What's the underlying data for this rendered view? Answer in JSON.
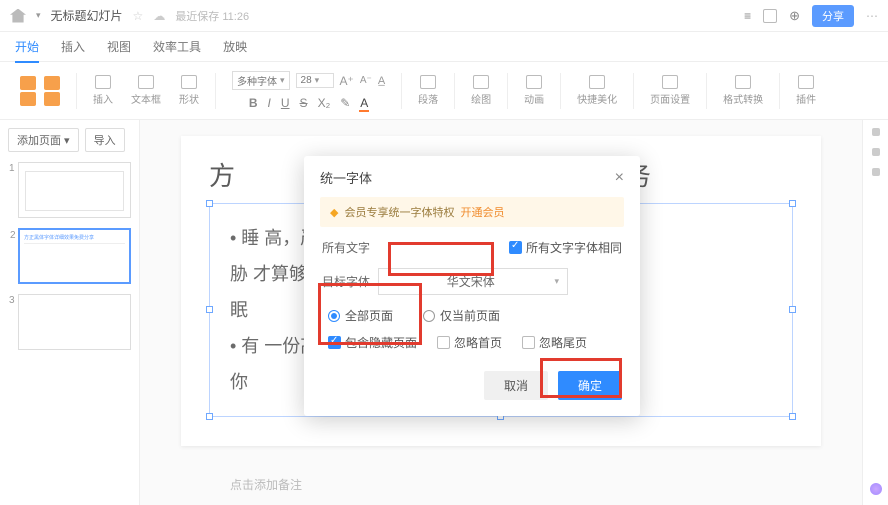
{
  "topbar": {
    "doc_title": "无标题幻灯片",
    "autosave": "最近保存 11:26",
    "share": "分享"
  },
  "menu": {
    "tabs": [
      "开始",
      "插入",
      "视图",
      "效率工具",
      "放映"
    ]
  },
  "ribbon": {
    "insert": "插入",
    "textbox": "文本框",
    "shape": "形状",
    "font_family": "多种字体",
    "font_size": "28",
    "paragraph": "段落",
    "draw": "绘图",
    "animation": "动画",
    "beautify": "快捷美化",
    "page_setup": "页面设置",
    "format_convert": "格式转换",
    "plugins": "插件"
  },
  "side": {
    "add_page": "添加页面",
    "import": "导入"
  },
  "slide": {
    "title_prefix": "方",
    "title_suffix": "务",
    "line1": "• 睡                                                                     高，严重时甚至可能威",
    "line2": "  胁                                                                     才算够吗？同样的睡",
    "line3": "  眠",
    "line4": "• 有                                                                     一份高质量睡眠指南祝",
    "line5": "  你"
  },
  "notes": {
    "placeholder": "点击添加备注"
  },
  "modal": {
    "title": "统一字体",
    "vip_text": "会员专享统一字体特权",
    "vip_link": "开通会员",
    "all_text": "所有文字",
    "same_font": "所有文字字体相同",
    "target_font_label": "目标字体",
    "target_font_value": "华文宋体",
    "radio_all": "全部页面",
    "radio_current": "仅当前页面",
    "chk_hidden": "包含隐藏页面",
    "chk_skip_first": "忽略首页",
    "chk_skip_last": "忽略尾页",
    "cancel": "取消",
    "ok": "确定"
  }
}
